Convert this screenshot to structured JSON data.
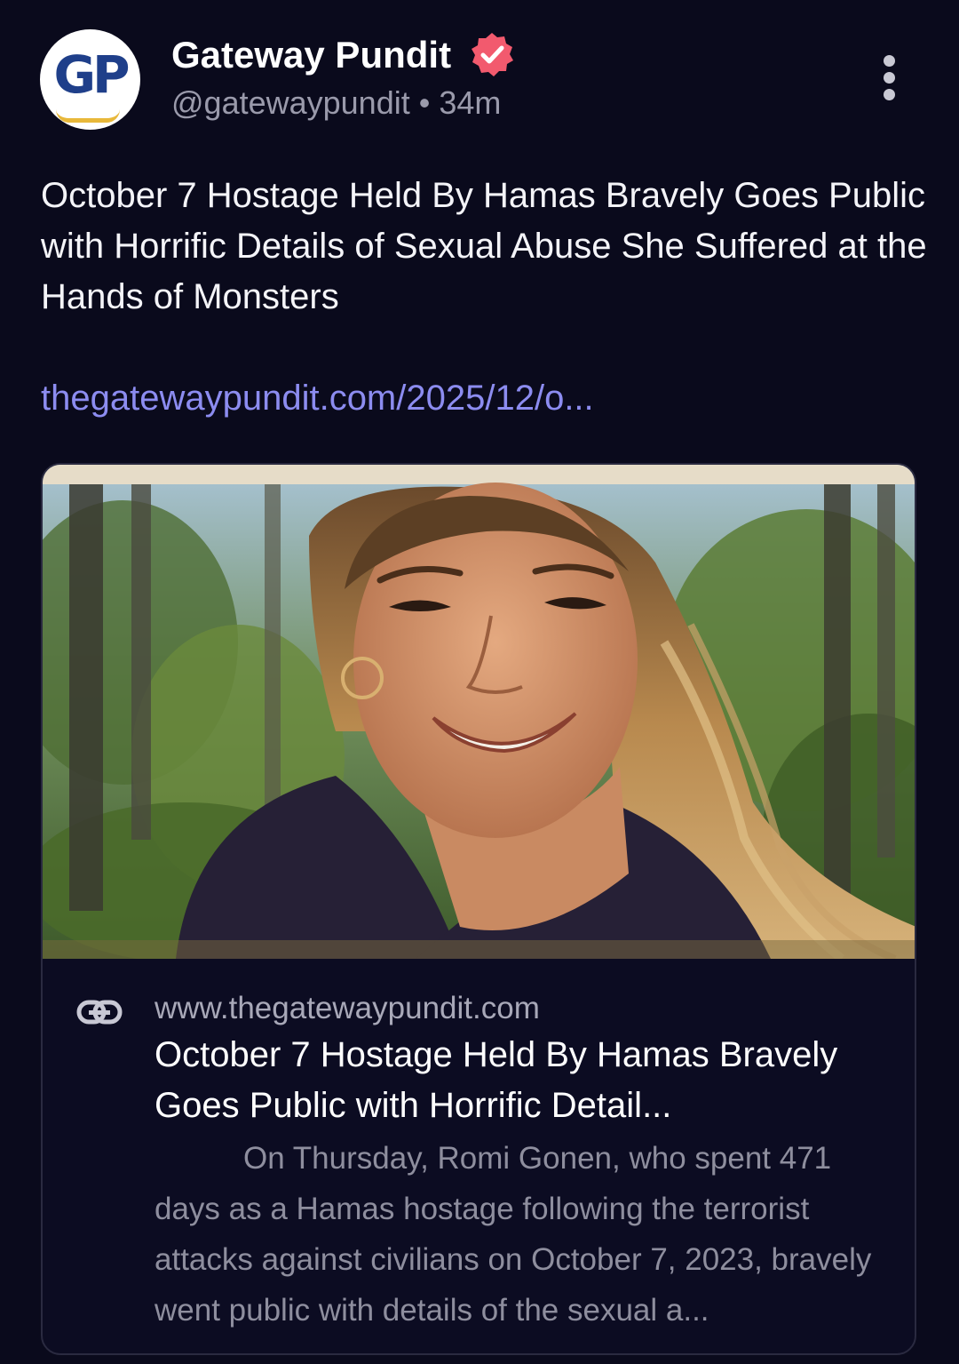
{
  "post": {
    "author": {
      "avatar_text": "GP",
      "name": "Gateway Pundit",
      "verified_icon": "verified-badge-icon",
      "handle": "@gatewaypundit",
      "separator": "•",
      "time": "34m"
    },
    "more_icon": "more-vertical-icon",
    "text": "October 7 Hostage Held By Hamas Bravely Goes Public with Horrific Details of Sexual Abuse She Suffered at the Hands of Monsters",
    "link": "thegatewaypundit.com/2025/12/o..."
  },
  "link_card": {
    "image_alt": "photo of smiling woman with long curly hair outdoors among trees",
    "link_icon": "link-icon",
    "domain": "www.thegatewaypundit.com",
    "title": "October 7 Hostage Held By Hamas Bravely Goes Public with Horrific Detail...",
    "description": "On Thursday, Romi Gonen, who spent 471 days as a Hamas hostage following the terrorist attacks against civilians on October 7, 2023, bravely went public with details of the sexual a..."
  },
  "colors": {
    "background": "#0a0a1c",
    "link": "#8c8cf0",
    "verified": "#f25a6e",
    "secondary_text": "#9a9aab"
  }
}
